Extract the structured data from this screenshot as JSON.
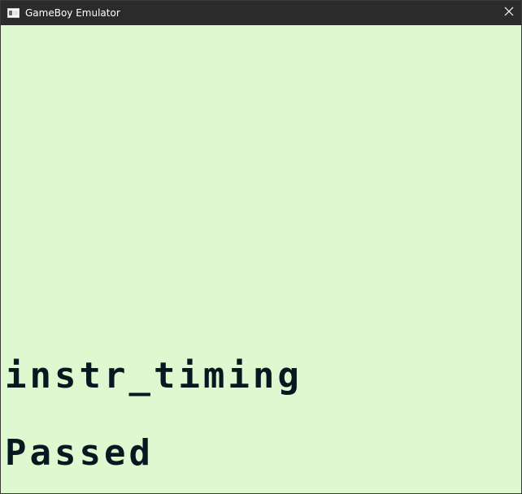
{
  "window": {
    "title": "GameBoy Emulator",
    "icon": "app-window-icon",
    "close_icon": "close-icon"
  },
  "screen": {
    "background_color": "#e0f8d0",
    "text_color": "#081820",
    "lines": [
      "instr_timing",
      "Passed"
    ]
  }
}
